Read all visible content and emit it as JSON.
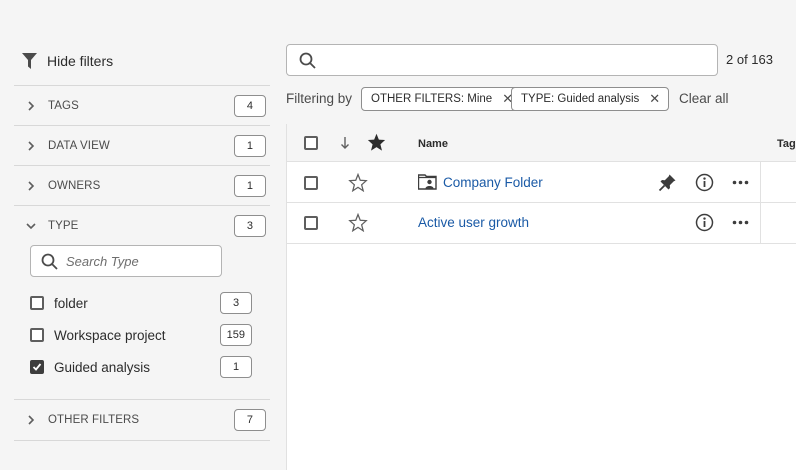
{
  "filters_panel": {
    "hide_label": "Hide filters",
    "facets": [
      {
        "label": "TAGS",
        "count": "4"
      },
      {
        "label": "DATA VIEW",
        "count": "1"
      },
      {
        "label": "OWNERS",
        "count": "1"
      },
      {
        "label": "TYPE",
        "count": "3"
      }
    ],
    "type_search": {
      "placeholder": "Search Type"
    },
    "type_options": [
      {
        "label": "folder",
        "count": "3",
        "checked": false
      },
      {
        "label": "Workspace project",
        "count": "159",
        "checked": false
      },
      {
        "label": "Guided analysis",
        "count": "1",
        "checked": true
      }
    ],
    "other_filters": {
      "label": "OTHER FILTERS",
      "count": "7"
    }
  },
  "search": {
    "placeholder": "",
    "result_count": "2 of 163"
  },
  "filter_bar": {
    "label": "Filtering by",
    "chips": [
      {
        "label": "OTHER FILTERS: Mine"
      },
      {
        "label": "TYPE: Guided analysis"
      }
    ],
    "clear_all": "Clear all"
  },
  "table": {
    "headers": {
      "name": "Name",
      "tags": "Tags"
    },
    "rows": [
      {
        "name": "Company Folder"
      },
      {
        "name": "Active user growth"
      }
    ]
  },
  "colors": {
    "link": "#1a5aa6",
    "background": "#f5f5f5"
  }
}
